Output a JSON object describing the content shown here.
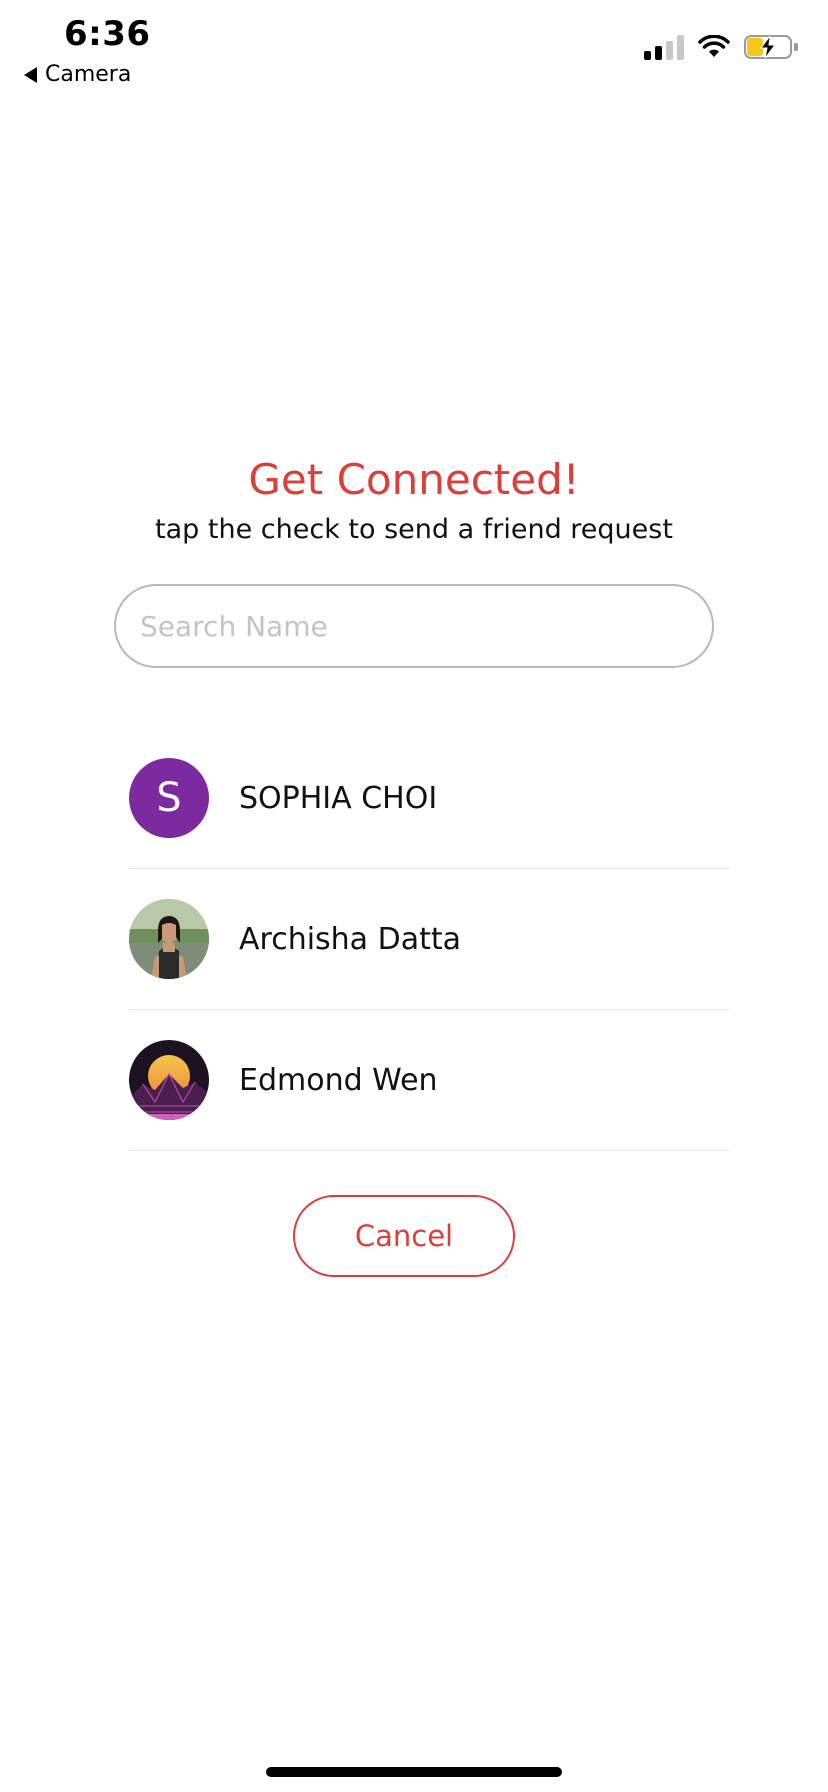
{
  "status_bar": {
    "time": "6:36",
    "back_label": "Camera"
  },
  "header": {
    "title": "Get Connected!",
    "subtitle": "tap the check to send a friend request"
  },
  "search": {
    "placeholder": "Search Name",
    "value": ""
  },
  "friends": [
    {
      "name": "SOPHIA CHOI",
      "avatar_type": "initial",
      "initial": "S",
      "avatar_color": "#7b2aa0"
    },
    {
      "name": "Archisha Datta",
      "avatar_type": "photo",
      "avatar_icon": "person-photo-icon"
    },
    {
      "name": "Edmond Wen",
      "avatar_type": "image",
      "avatar_icon": "sunset-mountain-icon"
    }
  ],
  "actions": {
    "cancel_label": "Cancel"
  },
  "colors": {
    "accent": "#d9403c",
    "divider": "#e6e6e6"
  }
}
